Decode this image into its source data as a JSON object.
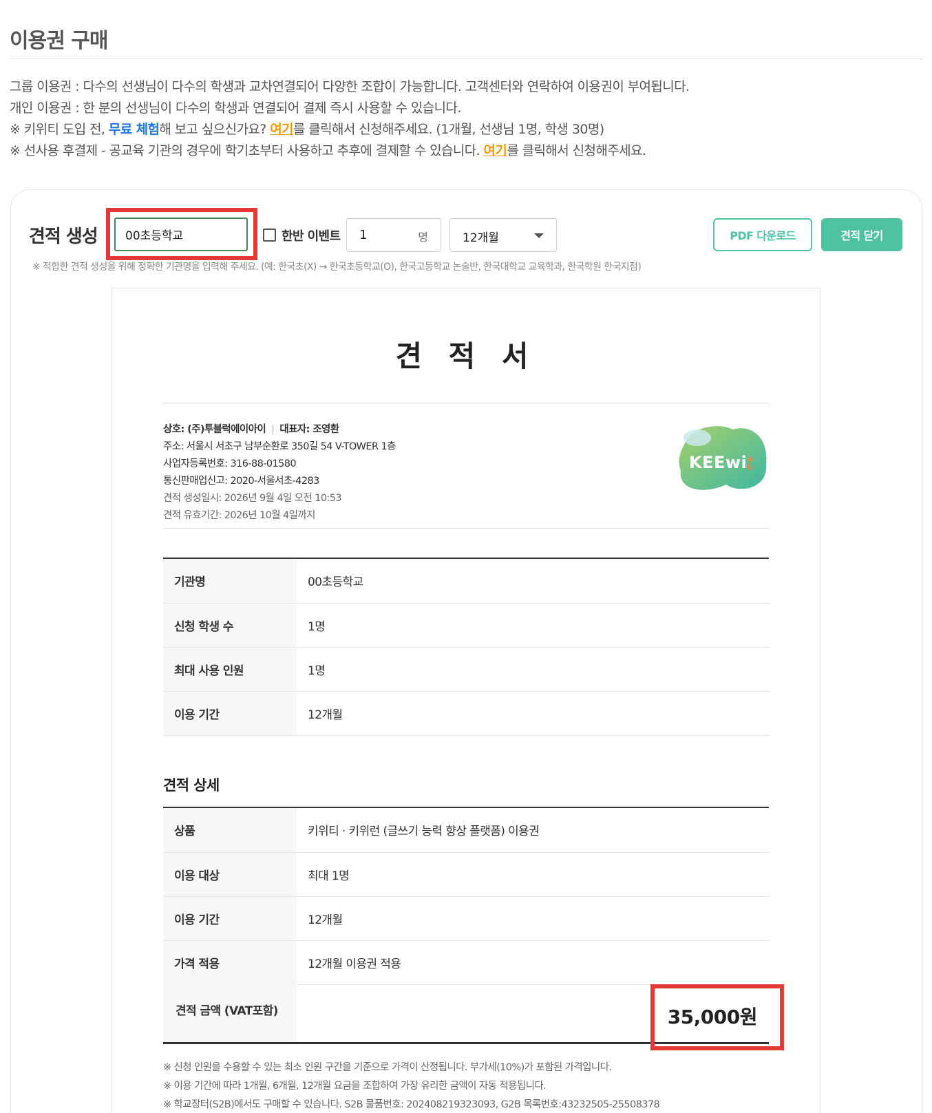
{
  "page": {
    "title": "이용권 구매"
  },
  "intro": {
    "line1": "그룹 이용권 : 다수의 선생님이 다수의 학생과 교차연결되어 다양한 조합이 가능합니다. 고객센터와 연락하여 이용권이 부여됩니다.",
    "line2": "개인 이용권 : 한 분의 선생님이 다수의 학생과 연결되어 결제 즉시 사용할 수 있습니다.",
    "line3_prefix": "※ 키위티 도입 전, ",
    "line3_link1": "무료 체험",
    "line3_mid": "해 보고 싶으신가요? ",
    "line3_link2": "여기",
    "line3_suffix": "를 클릭해서 신청해주세요. (1개월, 선생님 1명, 학생 30명)",
    "line4_prefix": "※ 선사용 후결제 - 공교육 기관의 경우에 학기초부터 사용하고 추후에 결제할 수 있습니다. ",
    "line4_link": "여기",
    "line4_suffix": "를 클릭해서 신청해주세요."
  },
  "quote_form": {
    "label": "견적 생성",
    "org_value": "00초등학교",
    "event_label": "한반 이벤트",
    "event_checked": false,
    "count_value": "1",
    "count_unit": "명",
    "period_selected": "12개월",
    "pdf_button": "PDF 다운로드",
    "close_button": "견적 닫기",
    "hint": "※ 적합한 견적 생성을 위해 정확한 기관명을 입력해 주세요. (예: 한국초(X) → 한국초등학교(O), 한국고등학교 논술반, 한국대학교 교육학과, 한국학원 한국지점)"
  },
  "document": {
    "title": "견 적 서",
    "company_name": "상호: (주)투블럭에이아이",
    "representative": "대표자: 조영환",
    "address": "주소: 서울시 서초구 남부순환로 350길 54 V-TOWER 1층",
    "business_number": "사업자등록번호: 316-88-01580",
    "ecommerce_number": "통신판매업신고: 2020-서울서초-4283",
    "created_at": "견적 생성일시: 2026년 9월 4일 오전 10:53",
    "valid_until": "견적 유효기간: 2026년 10월 4일까지",
    "logo_text": "KEEwit",
    "summary": [
      {
        "label": "기관명",
        "value": "00초등학교"
      },
      {
        "label": "신청 학생 수",
        "value": "1명"
      },
      {
        "label": "최대 사용 인원",
        "value": "1명"
      },
      {
        "label": "이용 기간",
        "value": "12개월"
      }
    ],
    "detail_title": "견적 상세",
    "details": [
      {
        "label": "상품",
        "value": "키위티 · 키위런 (글쓰기 능력 향상 플랫폼) 이용권"
      },
      {
        "label": "이용 대상",
        "value": "최대 1명"
      },
      {
        "label": "이용 기간",
        "value": "12개월"
      },
      {
        "label": "가격 적용",
        "value": "12개월 이용권 적용"
      }
    ],
    "total_label": "견적 금액 (VAT포함)",
    "total_amount": "35,000원",
    "notes": [
      "※ 신청 인원을 수용할 수 있는 최소 인원 구간을 기준으로 가격이 산정됩니다. 부가세(10%)가 포함된 가격입니다.",
      "※ 이용 기간에 따라 1개월, 6개월, 12개월 요금을 조합하여 가장 유리한 금액이 자동 적용됩니다.",
      "※ 학교장터(S2B)에서도 구매할 수 있습니다. S2B 물품번호: 202408219323093, G2B 목록번호:43232505-25508378"
    ]
  },
  "colors": {
    "accent": "#4fc3a1",
    "link_blue": "#1a73e8",
    "link_orange": "#f29900",
    "highlight_red": "#e53935"
  }
}
